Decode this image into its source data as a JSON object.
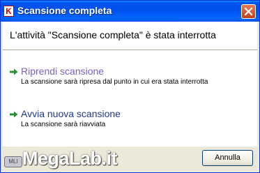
{
  "window": {
    "title": "Scansione completa",
    "app_icon_letter": "K",
    "close_icon": "close-icon"
  },
  "header": {
    "message": "L'attività \"Scansione completa\" è stata interrotta"
  },
  "options": [
    {
      "icon": "arrow-right-icon",
      "title": "Riprendi scansione",
      "description": "La scansione sarà ripresa dal punto in cui era stata interrotta"
    },
    {
      "icon": "arrow-right-icon",
      "title": "Avvia nuova scansione",
      "description": "La scansione sarà riavviata"
    }
  ],
  "watermark": {
    "badge": "MLI",
    "text": "MegaLab.it"
  },
  "footer": {
    "cancel_label": "Annulla"
  },
  "colors": {
    "titlebar": "#0053ee",
    "option_visited": "#7b5fbf",
    "option_link": "#1f3a8a",
    "arrow": "#2e8b3a"
  }
}
